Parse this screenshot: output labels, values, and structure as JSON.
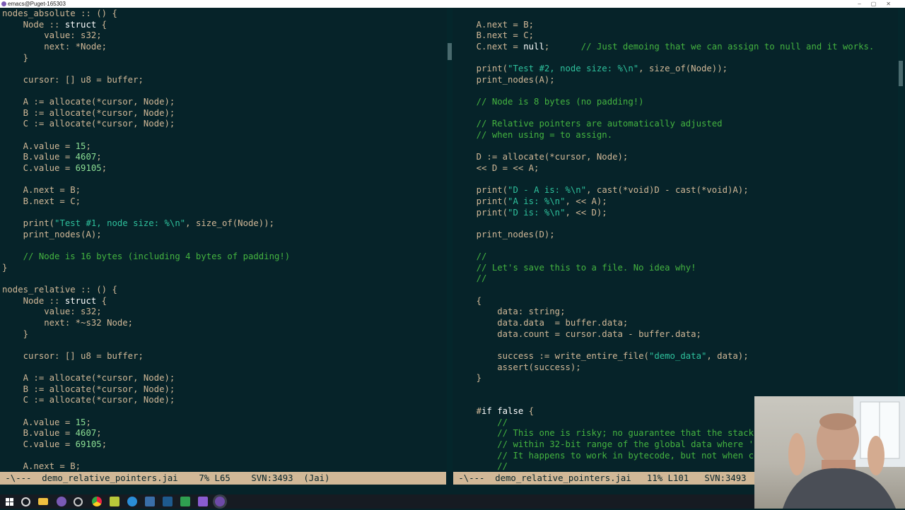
{
  "window": {
    "title": "emacs@Puget-165303"
  },
  "left_pane": {
    "lines": [
      "nodes_absolute :: () {",
      "    Node :: struct {",
      "        value: s32;",
      "        next: *Node;",
      "    }",
      "",
      "    cursor: [] u8 = buffer;",
      "",
      "    A := allocate(*cursor, Node);",
      "    B := allocate(*cursor, Node);",
      "    C := allocate(*cursor, Node);",
      "",
      "    A.value = 15;",
      "    B.value = 4607;",
      "    C.value = 69105;",
      "",
      "    A.next = B;",
      "    B.next = C;",
      "",
      "    print(\"Test #1, node size: %\\n\", size_of(Node));",
      "    print_nodes(A);",
      "",
      "    // Node is 16 bytes (including 4 bytes of padding!)",
      "}",
      "",
      "nodes_relative :: () {",
      "    Node :: struct {",
      "        value: s32;",
      "        next: *~s32 Node;",
      "    }",
      "",
      "    cursor: [] u8 = buffer;",
      "",
      "    A := allocate(*cursor, Node);",
      "    B := allocate(*cursor, Node);",
      "    C := allocate(*cursor, Node);",
      "",
      "    A.value = 15;",
      "    B.value = 4607;",
      "    C.value = 69105;",
      "",
      "    A.next = B;"
    ]
  },
  "right_pane": {
    "lines": [
      "",
      "    A.next = B;",
      "    B.next = C;",
      "    C.next = null;      // Just demoing that we can assign to null and it works.",
      "",
      "    print(\"Test #2, node size: %\\n\", size_of(Node));",
      "    print_nodes(A);",
      "",
      "    // Node is 8 bytes (no padding!)",
      "",
      "    // Relative pointers are automatically adjusted",
      "    // when using = to assign.",
      "",
      "    D := allocate(*cursor, Node);",
      "    << D = << A;",
      "",
      "    print(\"D - A is: %\\n\", cast(*void)D - cast(*void)A);",
      "    print(\"A is: %\\n\", << A);",
      "    print(\"D is: %\\n\", << D);",
      "",
      "    print_nodes(D);",
      "",
      "    //",
      "    // Let's save this to a file. No idea why!",
      "    //",
      "",
      "    {",
      "        data: string;",
      "        data.data  = buffer.data;",
      "        data.count = cursor.data - buffer.data;",
      "",
      "        success := write_entire_file(\"demo_data\", data);",
      "        assert(success);",
      "    }",
      "",
      "",
      "    #if false {",
      "        //",
      "        // This one is risky; no guarantee that the stack is",
      "        // within 32-bit range of the global data where 'b",
      "        // It happens to work in bytecode, but not when co",
      "        //"
    ]
  },
  "modeline_left": {
    "text": " -\\---  demo_relative_pointers.jai    7% L65    SVN:3493  (Jai)"
  },
  "modeline_right": {
    "text": " -\\---  demo_relative_pointers.jai   11% L101   SVN:3493  (Jai)"
  },
  "taskbar": {
    "icons": [
      "windows-start-icon",
      "search-icon",
      "file-explorer-icon",
      "emacs-icon",
      "settings-icon",
      "chrome-icon",
      "browser-icon",
      "build-icon",
      "terminal-icon",
      "image-viewer-icon",
      "visual-studio-icon",
      "emacs-active-icon"
    ]
  },
  "colors": {
    "background": "#062329",
    "text": "#d1b897",
    "keyword": "#ffffff",
    "string": "#2ec09c",
    "comment": "#44b340",
    "number": "#8cde94",
    "modeline_bg": "#d1b897"
  }
}
